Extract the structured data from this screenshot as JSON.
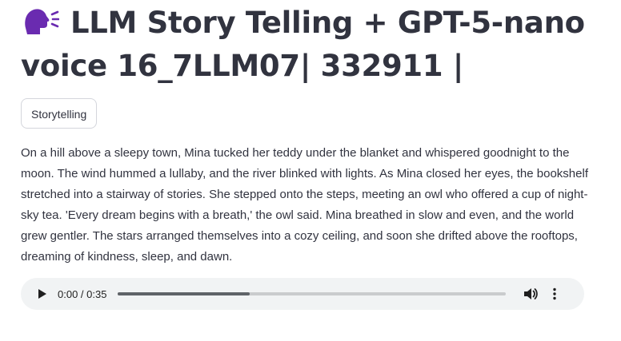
{
  "header": {
    "title": "LLM Story Telling + GPT-5-nano voice 16_7LLM07| 332911 |",
    "icon": "speaking-head-icon"
  },
  "tag": {
    "label": "Storytelling"
  },
  "story": {
    "text": "On a hill above a sleepy town, Mina tucked her teddy under the blanket and whispered goodnight to the moon. The wind hummed a lullaby, and the river blinked with lights. As Mina closed her eyes, the bookshelf stretched into a stairway of stories. She stepped onto the steps, meeting an owl who offered a cup of night-sky tea. 'Every dream begins with a breath,' the owl said. Mina breathed in slow and even, and the world grew gentler. The stars arranged themselves into a cozy ceiling, and soon she drifted above the rooftops, dreaming of kindness, sleep, and dawn."
  },
  "audio_player": {
    "time_display": "0:00 / 0:35",
    "progress": 0.34,
    "controls": [
      "play-icon",
      "volume-icon",
      "more-options-icon"
    ]
  },
  "colors": {
    "text": "#31333f",
    "icon_purple": "#6a2bb0",
    "player_bg": "#f1f3f4"
  }
}
